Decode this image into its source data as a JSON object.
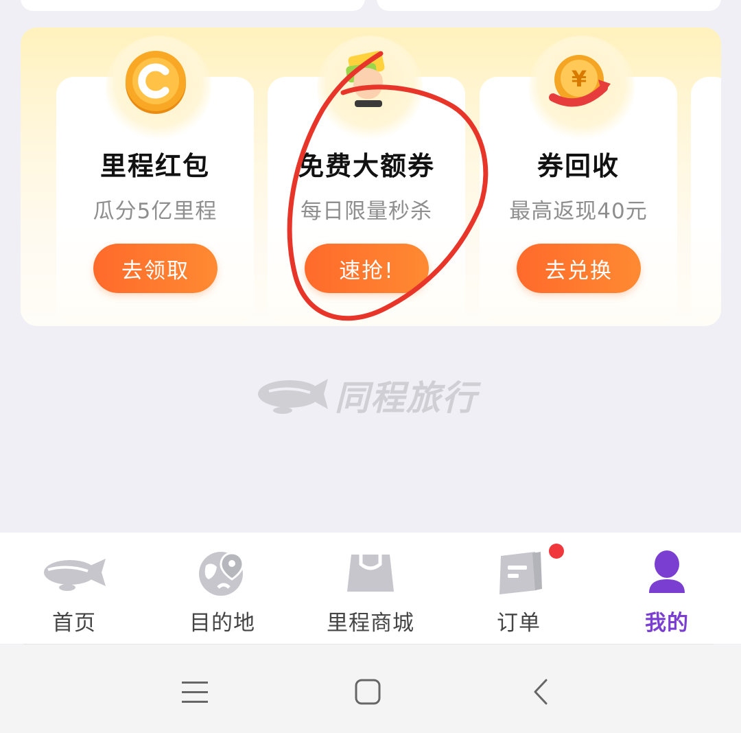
{
  "promo": {
    "cards": [
      {
        "title": "里程红包",
        "subtitle": "瓜分5亿里程",
        "button": "去领取",
        "icon": "coin-c-icon"
      },
      {
        "title": "免费大额券",
        "subtitle": "每日限量秒杀",
        "button": "速抢!",
        "icon": "coupon-hand-icon"
      },
      {
        "title": "券回收",
        "subtitle": "最高返现40元",
        "button": "去兑换",
        "icon": "yuan-coin-arrow-icon"
      }
    ]
  },
  "brand": {
    "name": "同程旅行",
    "icon": "airship-logo-icon"
  },
  "tabbar": {
    "items": [
      {
        "label": "首页",
        "icon": "airship-icon",
        "active": false
      },
      {
        "label": "目的地",
        "icon": "globe-pin-icon",
        "active": false
      },
      {
        "label": "里程商城",
        "icon": "shopping-bag-icon",
        "active": false
      },
      {
        "label": "订单",
        "icon": "order-document-icon",
        "active": false,
        "badge": true
      },
      {
        "label": "我的",
        "icon": "user-profile-icon",
        "active": true
      }
    ]
  },
  "colors": {
    "accent": "#ff6a2b",
    "active_tab": "#7a3fd1",
    "annotation": "#e8352a",
    "badge": "#f0373b"
  },
  "system_nav": {
    "buttons": [
      "menu-icon",
      "home-icon",
      "back-icon"
    ]
  }
}
